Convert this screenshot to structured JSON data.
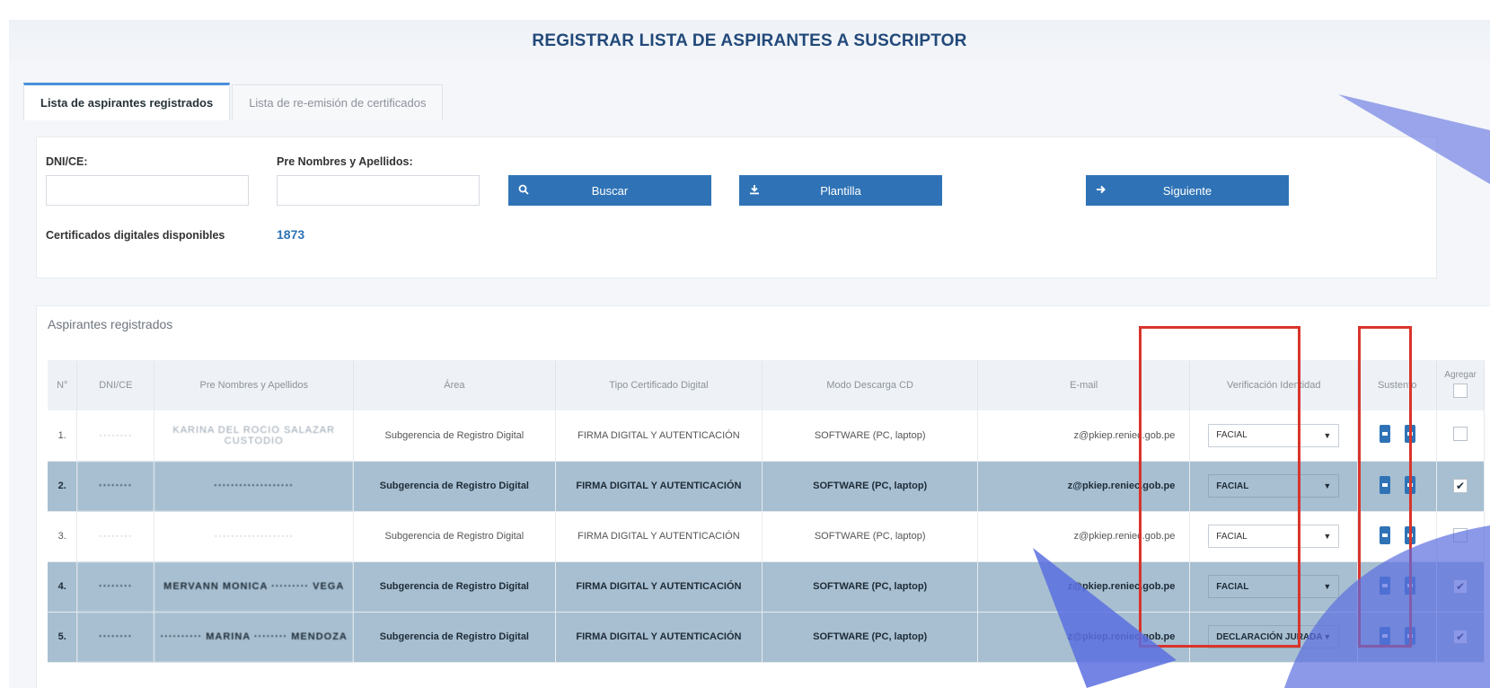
{
  "page": {
    "title": "REGISTRAR LISTA DE ASPIRANTES A SUSCRIPTOR"
  },
  "tabs": [
    {
      "label": "Lista de aspirantes registrados",
      "active": true
    },
    {
      "label": "Lista de re-emisión de certificados",
      "active": false
    }
  ],
  "search": {
    "dni_label": "DNI/CE:",
    "dni_value": "",
    "name_label": "Pre Nombres y Apellidos:",
    "name_value": "",
    "buscar_label": "Buscar",
    "plantilla_label": "Plantilla",
    "siguiente_label": "Siguiente",
    "available_label": "Certificados digitales disponibles",
    "available_value": "1873"
  },
  "section": {
    "title": "Aspirantes registrados"
  },
  "table": {
    "headers": [
      "N°",
      "DNI/CE",
      "Pre Nombres y Apellidos",
      "Área",
      "Tipo Certificado Digital",
      "Modo Descarga CD",
      "E-mail",
      "Verificación Identidad",
      "Sustento",
      "Agregar"
    ],
    "rows": [
      {
        "n": "1.",
        "dni": "········",
        "name": "KARINA DEL ROCIO SALAZAR CUSTODIO",
        "area": "Subgerencia de Registro Digital",
        "tipo": "FIRMA DIGITAL Y AUTENTICACIÓN",
        "modo": "SOFTWARE (PC, laptop)",
        "email": "z@pkiep.reniec.gob.pe",
        "verif": "FACIAL",
        "checked": false,
        "selected": false
      },
      {
        "n": "2.",
        "dni": "········",
        "name": "···················",
        "area": "Subgerencia de Registro Digital",
        "tipo": "FIRMA DIGITAL Y AUTENTICACIÓN",
        "modo": "SOFTWARE (PC, laptop)",
        "email": "z@pkiep.reniec.gob.pe",
        "verif": "FACIAL",
        "checked": true,
        "selected": true
      },
      {
        "n": "3.",
        "dni": "········",
        "name": "···················",
        "area": "Subgerencia de Registro Digital",
        "tipo": "FIRMA DIGITAL Y AUTENTICACIÓN",
        "modo": "SOFTWARE (PC, laptop)",
        "email": "z@pkiep.reniec.gob.pe",
        "verif": "FACIAL",
        "checked": false,
        "selected": false
      },
      {
        "n": "4.",
        "dni": "········",
        "name": "MERVANN MONICA ········· VEGA",
        "area": "Subgerencia de Registro Digital",
        "tipo": "FIRMA DIGITAL Y AUTENTICACIÓN",
        "modo": "SOFTWARE (PC, laptop)",
        "email": "z@pkiep.reniec.gob.pe",
        "verif": "FACIAL",
        "checked": true,
        "selected": true
      },
      {
        "n": "5.",
        "dni": "········",
        "name": "·········· MARINA ········ MENDOZA",
        "area": "Subgerencia de Registro Digital",
        "tipo": "FIRMA DIGITAL Y AUTENTICACIÓN",
        "modo": "SOFTWARE (PC, laptop)",
        "email": "z@pkiep.reniec.gob.pe",
        "verif": "DECLARACIÓN JURADA",
        "checked": true,
        "selected": true
      }
    ]
  },
  "colors": {
    "accent": "#2f73b6",
    "title": "#22497a",
    "highlight_box": "#d9342b",
    "selected_row": "#a7bfd0",
    "decoration": "#5b6ee0"
  },
  "icons": {
    "buscar": "search-icon",
    "plantilla": "download-icon",
    "siguiente": "arrow-right-icon",
    "sustento": "document-icon",
    "dropdown": "caret-down-icon"
  }
}
